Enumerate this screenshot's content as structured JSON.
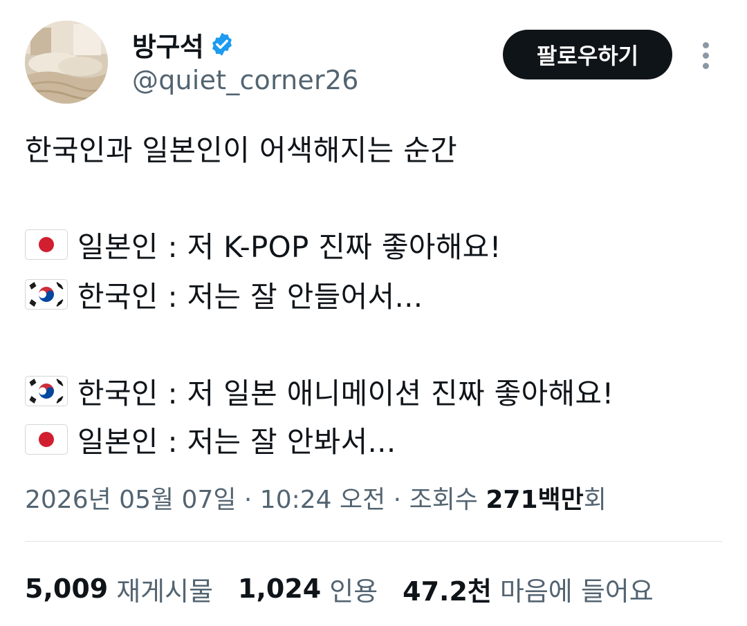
{
  "author": {
    "display_name": "방구석",
    "handle": "@quiet_corner26",
    "verified": true,
    "avatar_icon": "bedroom-photo-avatar"
  },
  "actions": {
    "follow_label": "팔로우하기",
    "more_icon": "more-vertical-icon"
  },
  "tweet": {
    "title": "한국인과 일본인이 어색해지는 순간",
    "lines": [
      {
        "flag": "japan-flag-icon",
        "text": "일본인 : 저 K-POP 진짜 좋아해요!"
      },
      {
        "flag": "korea-flag-icon",
        "text": "한국인 : 저는 잘 안들어서..."
      },
      {
        "flag": "korea-flag-icon",
        "text": "한국인 : 저 일본 애니메이션 진짜 좋아해요!"
      },
      {
        "flag": "japan-flag-icon",
        "text": "일본인 : 저는 잘 안봐서..."
      }
    ]
  },
  "meta": {
    "datetime": "2026년 05월 07일 · 10:24 오전 · 조회수 ",
    "views_number": "271백만",
    "views_suffix": "회"
  },
  "stats": {
    "retweets": {
      "count": "5,009",
      "label": "재게시물"
    },
    "quotes": {
      "count": "1,024",
      "label": "인용"
    },
    "likes": {
      "count": "47.2천",
      "label": "마음에 들어요"
    }
  },
  "colors": {
    "text": "#0f1419",
    "secondary": "#536471",
    "verified_blue": "#1d9bf0",
    "follow_bg": "#0f1419",
    "divider": "#dfe3e7"
  }
}
